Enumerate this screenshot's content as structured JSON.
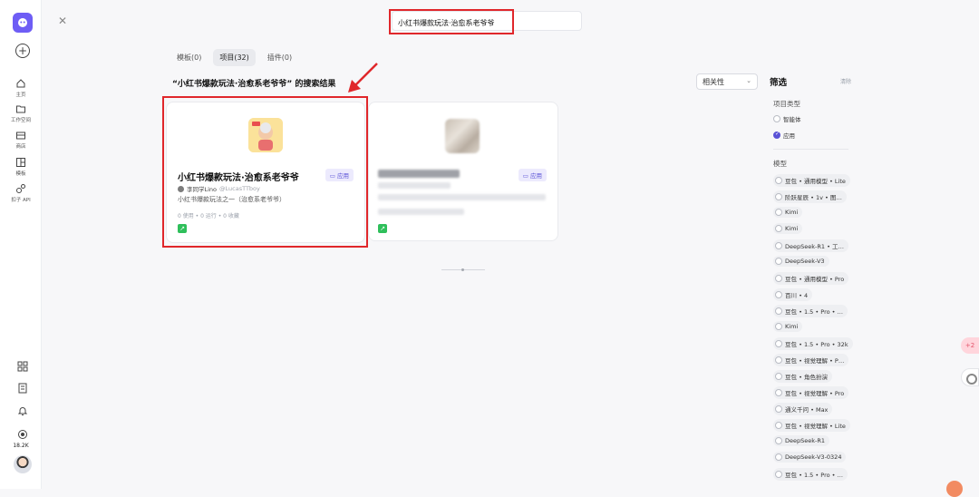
{
  "sidebar": {
    "items": [
      {
        "label": "主页",
        "icon": "home-icon"
      },
      {
        "label": "工作空间",
        "icon": "folder-icon"
      },
      {
        "label": "商店",
        "icon": "store-icon"
      },
      {
        "label": "模板",
        "icon": "template-icon"
      },
      {
        "label": "扣子 API",
        "icon": "api-icon"
      }
    ],
    "count_label": "18.2K"
  },
  "search": {
    "value": "小红书爆款玩法·治愈系老爷爷"
  },
  "tabs": [
    {
      "label": "模板(0)"
    },
    {
      "label": "项目(32)"
    },
    {
      "label": "插件(0)"
    }
  ],
  "result_title": "“小红书爆款玩法·治愈系老爷爷” 的搜索结果",
  "sort": {
    "selected": "相关性"
  },
  "cards": [
    {
      "title": "小红书爆款玩法·治愈系老爷爷",
      "tag": "应用",
      "author_name": "李同学Lino",
      "author_handle": "@LucasTTboy",
      "desc": "小红书爆款玩法之一（治愈系老爷爷）",
      "stats": "0 使用 • 0 运行 • 0 收藏"
    },
    {
      "tag": "应用"
    }
  ],
  "filter": {
    "title": "筛选",
    "clear": "清除",
    "type_section": "项目类型",
    "types": [
      {
        "label": "智能体",
        "checked": false
      },
      {
        "label": "应用",
        "checked": true
      }
    ],
    "model_section": "模型",
    "models": [
      "豆包 • 通用模型 • Lite",
      "阶跃星辰 • 1v • 图…",
      "Kimi",
      "Kimi",
      "DeepSeek-R1 • 工…",
      "DeepSeek-V3",
      "豆包 • 通用模型 • Pro",
      "百川 • 4",
      "豆包 • 1.5 • Pro • …",
      "Kimi",
      "豆包 • 1.5 • Pro • 32k",
      "豆包 • 视觉理解 • P…",
      "豆包 • 角色扮演",
      "豆包 • 视觉理解 • Pro",
      "通义千问 • Max",
      "豆包 • 视觉理解 • Lite",
      "DeepSeek-R1",
      "DeepSeek-V3-0324",
      "豆包 • 1.5 • Pro • …"
    ]
  },
  "colors": {
    "accent": "#6e5df5",
    "highlight": "#e0272b",
    "share": "#2fbf5b"
  }
}
